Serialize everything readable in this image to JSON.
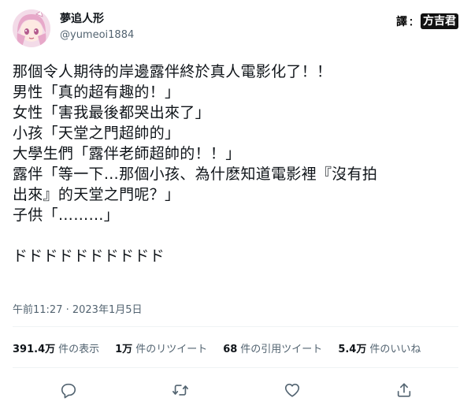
{
  "author": {
    "display_name": "夢追人形",
    "handle": "@yumeoi1884",
    "avatar_icon": "anime-avatar-icon"
  },
  "credit": {
    "label": "譯",
    "separator": "：",
    "name": "方吉君"
  },
  "tweet": {
    "lines": [
      "那個令人期待的岸邊露伴終於真人電影化了！！",
      "男性「真的超有趣的！」",
      "女性「害我最後都哭出來了」",
      "小孩「天堂之門超帥的」",
      "大學生們「露伴老師超帥的！！」",
      "露伴「等一下…那個小孩、為什麽知道電影裡『沒有拍",
      "出來』的天堂之門呢？」",
      "子供「………」",
      "",
      "ドドドドドドドドドド"
    ]
  },
  "timestamp": "午前11:27 · 2023年1月5日",
  "stats": [
    {
      "value": "391.4万",
      "label": "件の表示"
    },
    {
      "value": "1万",
      "label": "件のリツイート"
    },
    {
      "value": "68",
      "label": "件の引用ツイート"
    },
    {
      "value": "5.4万",
      "label": "件のいいね"
    }
  ],
  "actions": [
    "reply-icon",
    "retweet-icon",
    "like-icon",
    "share-icon"
  ],
  "colors": {
    "text": "#0f1419",
    "secondary": "#536471",
    "divider": "#eff3f4"
  }
}
